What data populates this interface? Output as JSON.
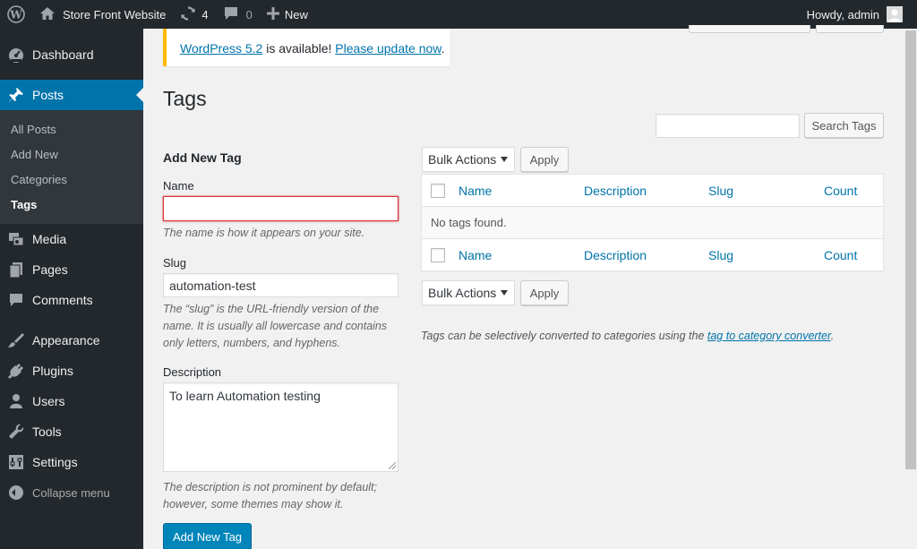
{
  "adminbar": {
    "site_name": "Store Front Website",
    "updates_count": "4",
    "comments_count": "0",
    "new_label": "New",
    "howdy": "Howdy, admin"
  },
  "sidebar": {
    "items": [
      {
        "label": "Dashboard"
      },
      {
        "label": "Posts"
      },
      {
        "label": "Media"
      },
      {
        "label": "Pages"
      },
      {
        "label": "Comments"
      },
      {
        "label": "Appearance"
      },
      {
        "label": "Plugins"
      },
      {
        "label": "Users"
      },
      {
        "label": "Tools"
      },
      {
        "label": "Settings"
      }
    ],
    "posts_sub": [
      "All Posts",
      "Add New",
      "Categories",
      "Tags"
    ],
    "collapse_label": "Collapse menu"
  },
  "notice": {
    "link1": "WordPress 5.2",
    "text": " is available! ",
    "link2": "Please update now",
    "end": "."
  },
  "page": {
    "title": "Tags"
  },
  "search": {
    "value": "",
    "button": "Search Tags"
  },
  "form": {
    "heading": "Add New Tag",
    "name_label": "Name",
    "name_value": "",
    "name_help": "The name is how it appears on your site.",
    "slug_label": "Slug",
    "slug_value": "automation-test",
    "slug_help": "The “slug” is the URL-friendly version of the name. It is usually all lowercase and contains only letters, numbers, and hyphens.",
    "description_label": "Description",
    "description_value": "To learn Automation testing",
    "description_help": "The description is not prominent by default; however, some themes may show it.",
    "submit": "Add New Tag"
  },
  "table": {
    "bulk_actions": "Bulk Actions",
    "apply": "Apply",
    "columns": [
      "Name",
      "Description",
      "Slug",
      "Count"
    ],
    "empty_message": "No tags found."
  },
  "converter": {
    "text": "Tags can be selectively converted to categories using the ",
    "link": "tag to category converter",
    "end": "."
  },
  "colors": {
    "adminbar_bg": "#23282d",
    "accent": "#0073aa",
    "primary_button": "#0085ba",
    "notice_border": "#ffb900",
    "error_border": "#dc3232"
  }
}
